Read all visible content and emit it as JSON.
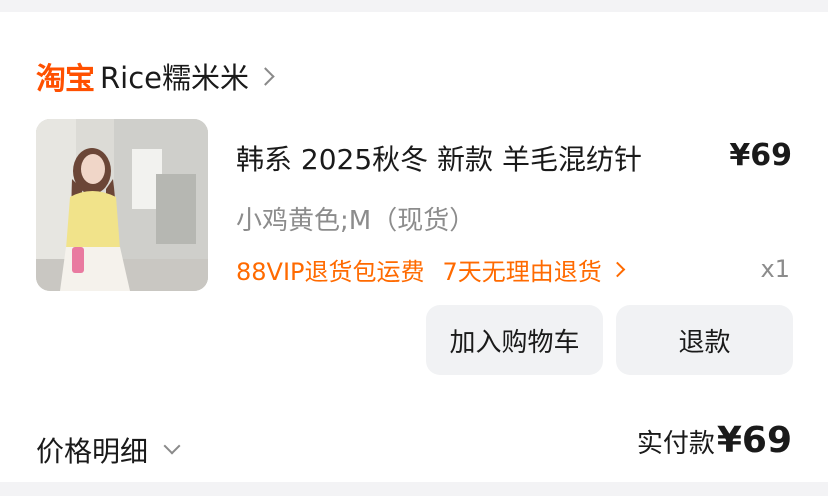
{
  "shop": {
    "platform": "淘宝",
    "name": "Rice糯米米"
  },
  "item": {
    "title": "韩系 2025秋冬 新款 羊毛混纺针",
    "price": "¥69",
    "spec": "小鸡黄色;M（现货）",
    "promo_vip": "88VIP退货包运费",
    "promo_return": "7天无理由退货",
    "quantity": "x1"
  },
  "actions": {
    "add_to_cart": "加入购物车",
    "refund": "退款"
  },
  "summary": {
    "price_detail": "价格明细",
    "paid_label": "实付款",
    "paid_amount": "¥69"
  },
  "colors": {
    "brand": "#ff5000",
    "promo": "#ff6a00",
    "button_bg": "#f1f2f4"
  }
}
